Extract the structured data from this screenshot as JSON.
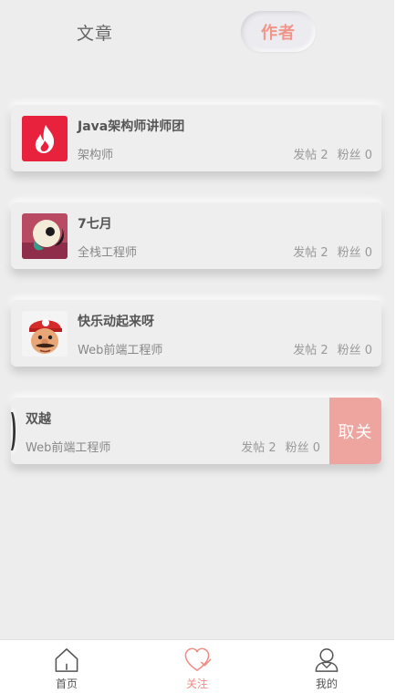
{
  "tabs": {
    "article": "文章",
    "author": "作者"
  },
  "colors": {
    "accent": "#f0958a",
    "unfollow_bg": "#eea59f"
  },
  "authors": [
    {
      "name": "Java架构师讲师团",
      "title": "架构师",
      "posts": "发帖 2",
      "fans": "粉丝 0",
      "avatar_icon": "flame-logo-icon"
    },
    {
      "name": "7七月",
      "title": "全栈工程师",
      "posts": "发帖 2",
      "fans": "粉丝 0",
      "avatar_icon": "cartoon-avatar-icon"
    },
    {
      "name": "快乐动起来呀",
      "title": "Web前端工程师",
      "posts": "发帖 2",
      "fans": "粉丝 0",
      "avatar_icon": "mario-avatar-icon"
    },
    {
      "name": "双越",
      "title": "Web前端工程师",
      "posts": "发帖 2",
      "fans": "粉丝 0",
      "avatar_icon": "avatar-icon",
      "swipe_action": "取关"
    }
  ],
  "nav": [
    {
      "label": "首页",
      "icon": "home-icon"
    },
    {
      "label": "关注",
      "icon": "heart-check-icon",
      "active": true
    },
    {
      "label": "我的",
      "icon": "user-icon"
    }
  ]
}
